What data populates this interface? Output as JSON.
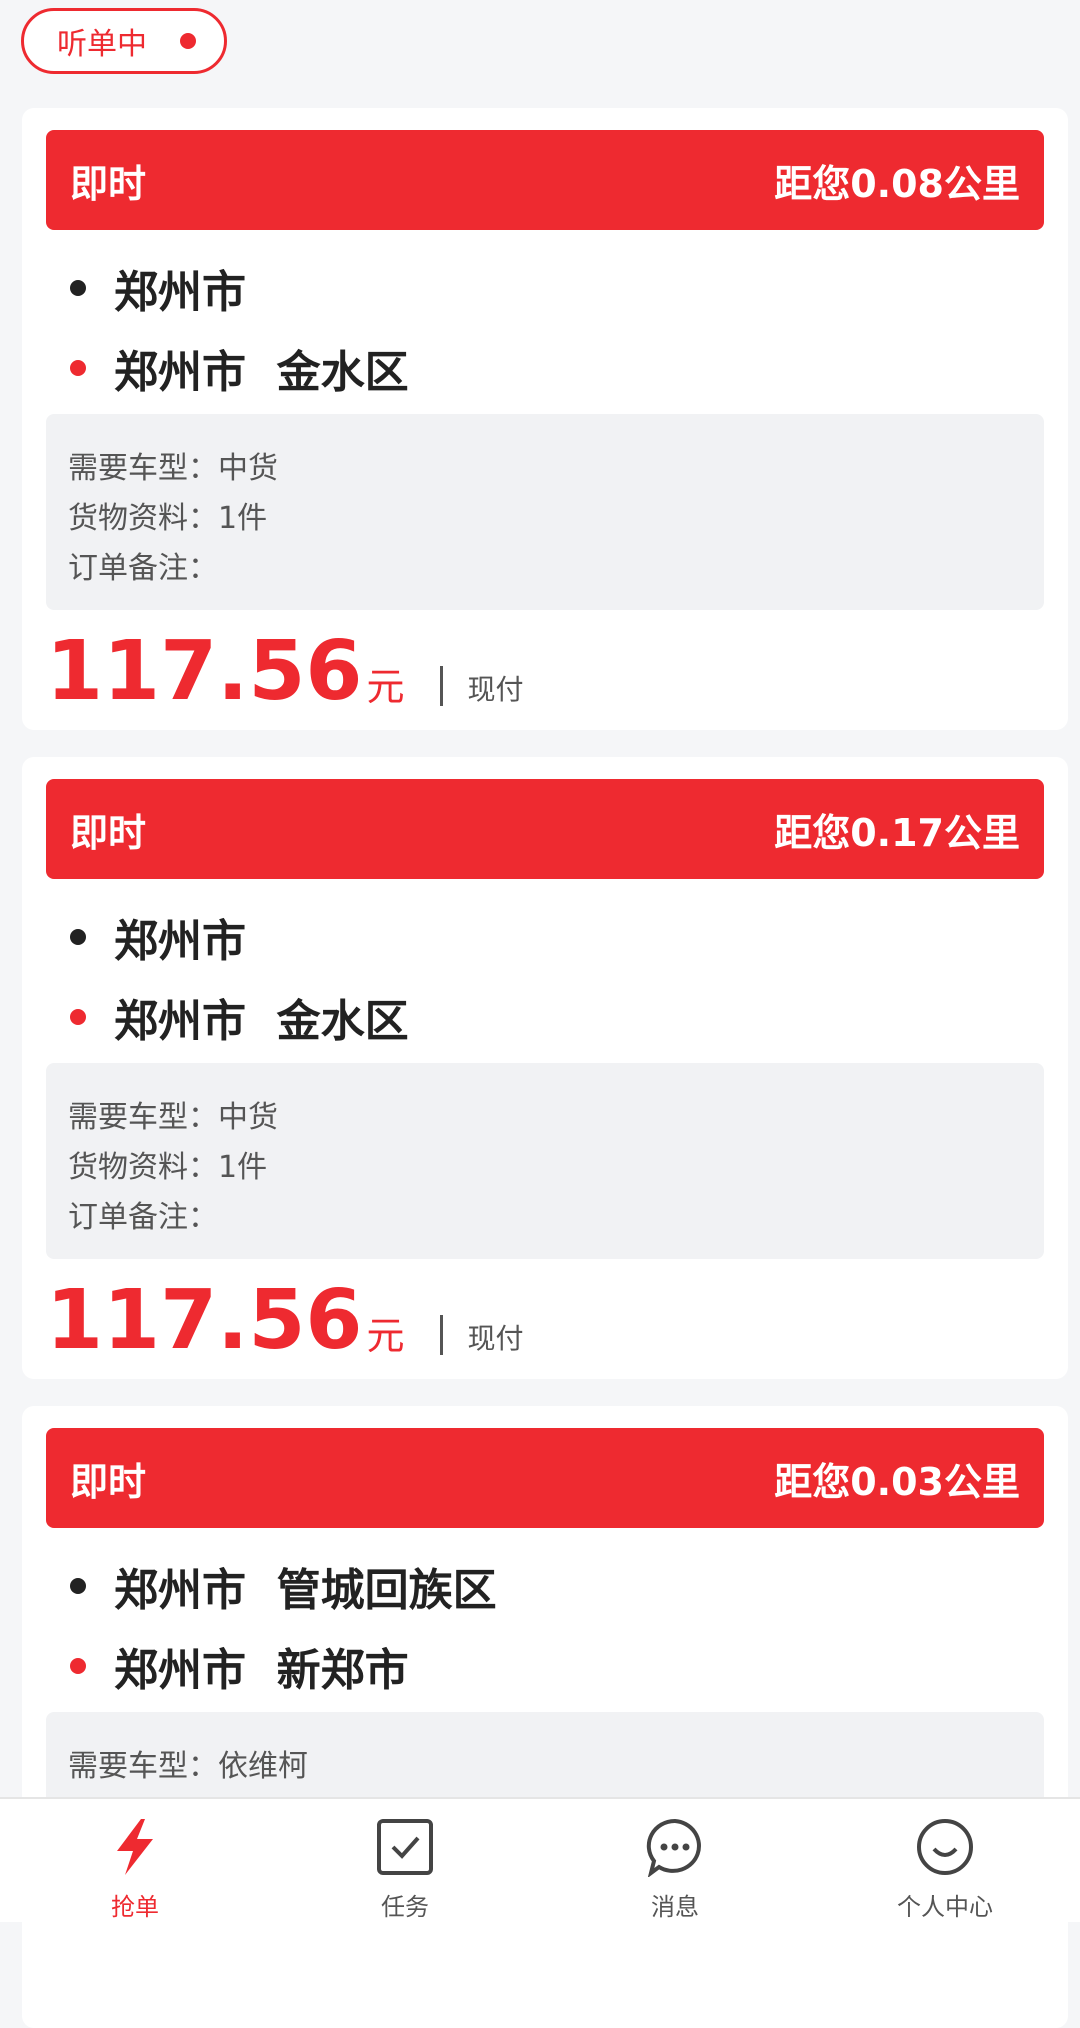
{
  "status": {
    "label": "听单中"
  },
  "orders": [
    {
      "type": "即时",
      "distance": "距您0.08公里",
      "from": "郑州市",
      "to": "郑州市  金水区",
      "vehicle": "需要车型：中货",
      "cargo": "货物资料：1件",
      "remark": "订单备注：",
      "price": "117.56",
      "unit": "元",
      "payment": "现付"
    },
    {
      "type": "即时",
      "distance": "距您0.17公里",
      "from": "郑州市",
      "to": "郑州市  金水区",
      "vehicle": "需要车型：中货",
      "cargo": "货物资料：1件",
      "remark": "订单备注：",
      "price": "117.56",
      "unit": "元",
      "payment": "现付"
    },
    {
      "type": "即时",
      "distance": "距您0.03公里",
      "from": "郑州市  管城回族区",
      "to": "郑州市  新郑市",
      "vehicle": "需要车型：依维柯",
      "cargo": "",
      "remark": "",
      "price": "",
      "unit": "",
      "payment": ""
    }
  ],
  "tabbar": [
    {
      "label": "抢单",
      "icon": "lightning-icon"
    },
    {
      "label": "任务",
      "icon": "task-check-icon"
    },
    {
      "label": "消息",
      "icon": "message-bubble-icon"
    },
    {
      "label": "个人中心",
      "icon": "smile-profile-icon"
    }
  ],
  "colors": {
    "accent": "#ee2a30",
    "background": "#f5f6f8"
  }
}
